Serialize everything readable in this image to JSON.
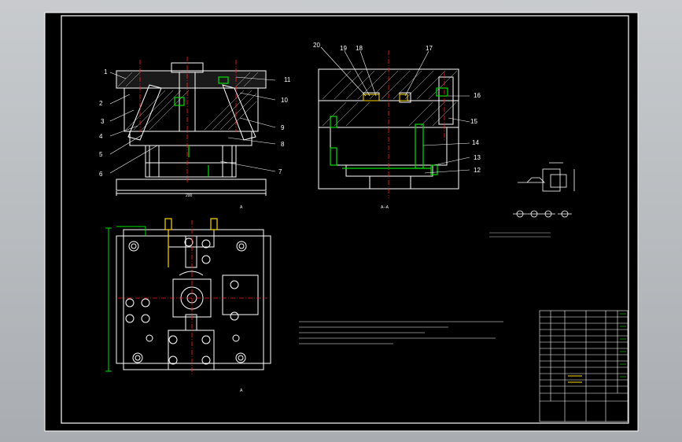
{
  "drawing": {
    "part_callouts_left": [
      "1",
      "2",
      "3",
      "4",
      "5",
      "6",
      "7",
      "8",
      "9",
      "10",
      "11"
    ],
    "part_callouts_right": [
      "20",
      "19",
      "18",
      "17",
      "16",
      "15",
      "14",
      "13",
      "12"
    ],
    "section_label": "A--A",
    "section_marker": "A",
    "dimension_label": "200"
  },
  "colors": {
    "background": "#000000",
    "line": "#ffffff",
    "accent_red": "#ff2020",
    "accent_green": "#00e000",
    "accent_yellow": "#ffd700"
  },
  "icons": [
    "mold-assembly-drawing",
    "section-view",
    "plan-view",
    "title-block"
  ]
}
